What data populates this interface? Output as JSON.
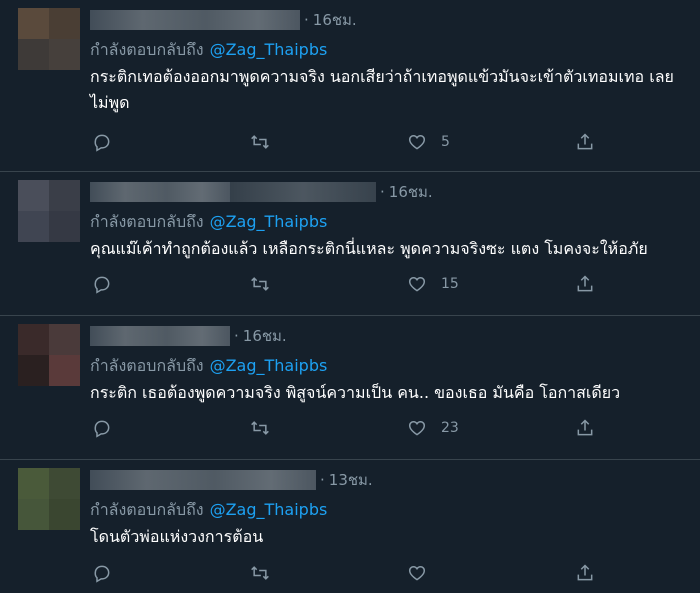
{
  "reply_prefix": "กำลังตอบกลับถึง",
  "tweets": [
    {
      "time": "16ชม.",
      "handle": "@Zag_Thaipbs",
      "text": "กระติกเทอต้องออกมาพูดความจริง นอกเสียว่าถ้าเทอพูดแข้วมันจะเข้าตัวเทอมเทอ เลยไม่พูด",
      "likes": "5",
      "avatar_colors": [
        "#5a4a3c",
        "#4a3e34",
        "#3e3a38",
        "#46403c"
      ]
    },
    {
      "time": "16ชม.",
      "handle": "@Zag_Thaipbs",
      "text": "คุณแม๊เค้าทำถูกต้องแล้ว เหลือกระติกนี่แหละ พูดความจริงซะ แตง โมคงจะให้อภัย",
      "likes": "15",
      "avatar_colors": [
        "#4a4e5a",
        "#3a3e48",
        "#404552",
        "#353944"
      ]
    },
    {
      "time": "16ชม.",
      "handle": "@Zag_Thaipbs",
      "text": "กระติก เธอต้องพูดความจริง พิสูจน์ความเป็น คน.. ของเธอ มันคือ โอกาสเดียว",
      "likes": "23",
      "avatar_colors": [
        "#3a2a2a",
        "#4a3a3a",
        "#2a2020",
        "#5a3a3a"
      ]
    },
    {
      "time": "13ชม.",
      "handle": "@Zag_Thaipbs",
      "text": "โดนตัวพ่อแห่งวงการต้อน",
      "likes": "",
      "avatar_colors": [
        "#4a5a3a",
        "#3e4a34",
        "#46563a",
        "#3a4630"
      ]
    }
  ],
  "icons": {
    "reply": "comment-icon",
    "retweet": "retweet-icon",
    "like": "heart-icon",
    "share": "share-icon"
  }
}
